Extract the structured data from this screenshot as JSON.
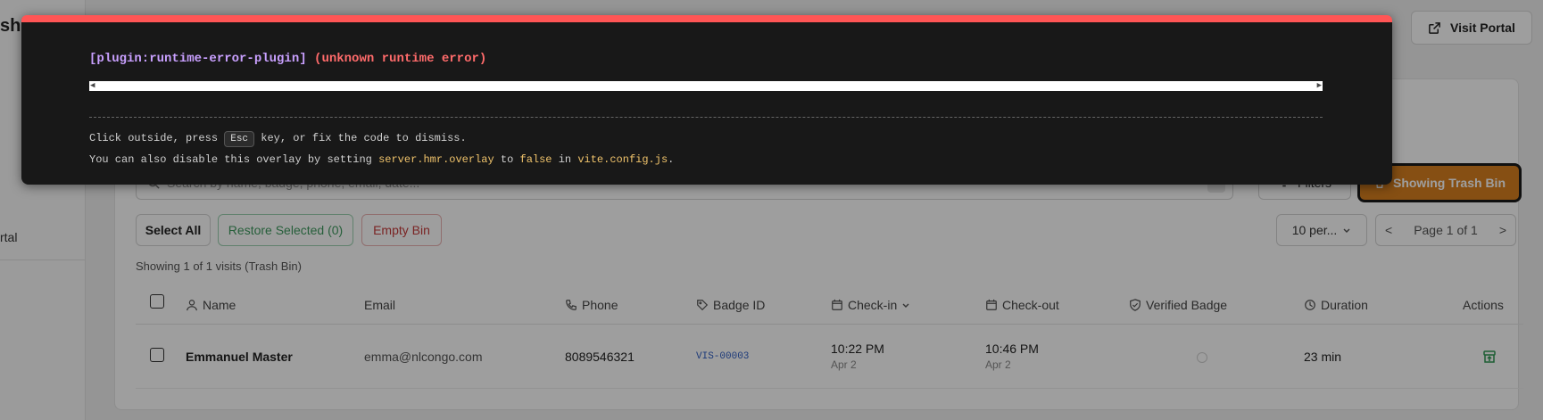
{
  "sidebar": {
    "brand_fragment": "shb",
    "nav_item_fragment": "rtal"
  },
  "header": {
    "visit_portal_label": "Visit Portal"
  },
  "toolbar": {
    "search_placeholder": "Search by name, badge, phone, email, date...",
    "filters_label": "Filters",
    "trash_toggle_label": "Showing Trash Bin",
    "select_all_label": "Select All",
    "restore_label": "Restore Selected (0)",
    "empty_bin_label": "Empty Bin",
    "per_page_label": "10 per...",
    "page_label": "Page 1 of 1",
    "prev_symbol": "<",
    "next_symbol": ">"
  },
  "summary_text": "Showing 1 of 1 visits (Trash Bin)",
  "table": {
    "columns": [
      "Name",
      "Email",
      "Phone",
      "Badge ID",
      "Check-in",
      "Check-out",
      "Verified Badge",
      "Duration",
      "Actions"
    ],
    "rows": [
      {
        "name": "Emmanuel Master",
        "email": "emma@nlcongo.com",
        "phone": "8089546321",
        "badge_id": "VIS-00003",
        "check_in_time": "10:22 PM",
        "check_in_date": "Apr 2",
        "check_out_time": "10:46 PM",
        "check_out_date": "Apr 2",
        "duration": "23 min"
      }
    ]
  },
  "overlay": {
    "plugin": "[plugin:runtime-error-plugin]",
    "message": "(unknown runtime error)",
    "tip1_pre": "Click outside, press ",
    "tip1_key": "Esc",
    "tip1_post": " key, or fix the code to dismiss.",
    "tip2_pre": "You can also disable this overlay by setting ",
    "tip2_code1": "server.hmr.overlay",
    "tip2_mid1": " to ",
    "tip2_code2": "false",
    "tip2_mid2": " in ",
    "tip2_code3": "vite.config.js",
    "tip2_post": "."
  },
  "colors": {
    "overlay_border": "#ff5555",
    "trash_accent": "#d9801f",
    "restore_green": "#3f9a5f",
    "empty_red": "#c53b3b"
  }
}
